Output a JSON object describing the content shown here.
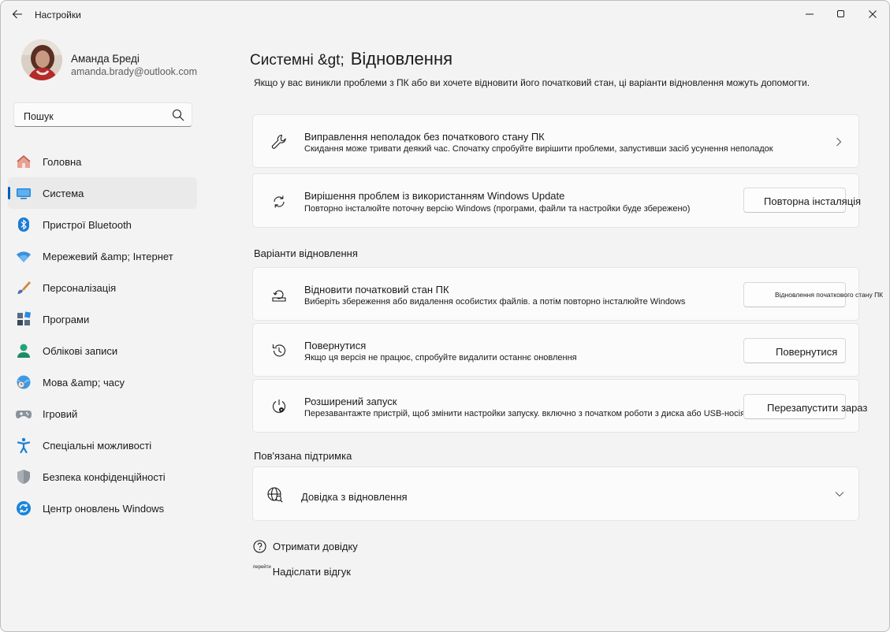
{
  "window": {
    "app_title": "Настройки",
    "back_icon": "arrow-left-icon",
    "controls": [
      "minimize-icon",
      "maximize-icon",
      "close-icon"
    ]
  },
  "user": {
    "name": "Аманда Бреді",
    "email": "amanda.brady@outlook.com"
  },
  "search": {
    "value": "Пошук"
  },
  "sidebar": {
    "items": [
      {
        "label": "Головна",
        "icon": "home-icon",
        "selected": false
      },
      {
        "label": "Система",
        "icon": "system-monitor-icon",
        "selected": true
      },
      {
        "label": "Пристрої Bluetooth",
        "icon": "bluetooth-icon",
        "selected": false
      },
      {
        "label": "Мережевий &amp; Інтернет",
        "icon": "wifi-icon",
        "selected": false
      },
      {
        "label": "Персоналізація",
        "icon": "brush-icon",
        "selected": false
      },
      {
        "label": "Програми",
        "icon": "apps-icon",
        "selected": false
      },
      {
        "label": "Облікові записи",
        "icon": "person-icon",
        "selected": false
      },
      {
        "label": "Мова &amp; часу",
        "icon": "globe-clock-icon",
        "selected": false
      },
      {
        "label": "Ігровий",
        "icon": "gamepad-icon",
        "selected": false
      },
      {
        "label": "Спеціальні можливості",
        "icon": "accessibility-icon",
        "selected": false
      },
      {
        "label": "Безпека конфіденційності",
        "icon": "shield-icon",
        "selected": false
      },
      {
        "label": "Центр оновлень Windows",
        "icon": "windows-update-icon",
        "selected": false
      }
    ]
  },
  "main": {
    "breadcrumb_parent": "Системні &gt;",
    "title": "Відновлення",
    "intro": "Якщо у вас виникли проблеми з ПК або ви хочете відновити його початковий стан, ці варіанти відновлення можуть допомогти.",
    "troubleshoot": {
      "title": "Виправлення неполадок без початкового стану ПК",
      "desc": "Скидання може тривати деякий час. Спочатку спробуйте вирішити проблеми, запустивши засіб усунення неполадок"
    },
    "windows_update": {
      "title": "Вирішення проблем із використанням Windows Update",
      "desc": "Повторно інсталюйте поточну версію Windows (програми, файли та настройки буде збережено)",
      "button": "Повторна інсталяція"
    },
    "recovery_section": "Варіанти відновлення",
    "reset": {
      "title": "Відновити початковий стан ПК",
      "desc": "Виберіть збереження або видалення особистих файлів. а потім повторно інсталюйте Windows",
      "button": "Відновлення початкового стану ПК"
    },
    "goback": {
      "title": "Повернутися",
      "desc": "Якщо ця версія не працює, спробуйте видалити останнє оновлення",
      "button": "Повернутися"
    },
    "advanced": {
      "title": "Розширений запуск",
      "desc": "Перезавантажте пристрій, щоб змінити настройки запуску. включно з початком роботи з диска або USB-носія",
      "button": "Перезапустити зараз"
    },
    "support_section": "Пов'язана підтримка",
    "help_recovery": "Довідка з відновлення",
    "get_help": "Отримати довідку",
    "feedback_prefix": "перейти",
    "feedback": "Надіслати відгук"
  },
  "colors": {
    "accent": "#005fb8",
    "window_bg": "#f3f3f3",
    "card_bg": "#fbfbfb"
  }
}
